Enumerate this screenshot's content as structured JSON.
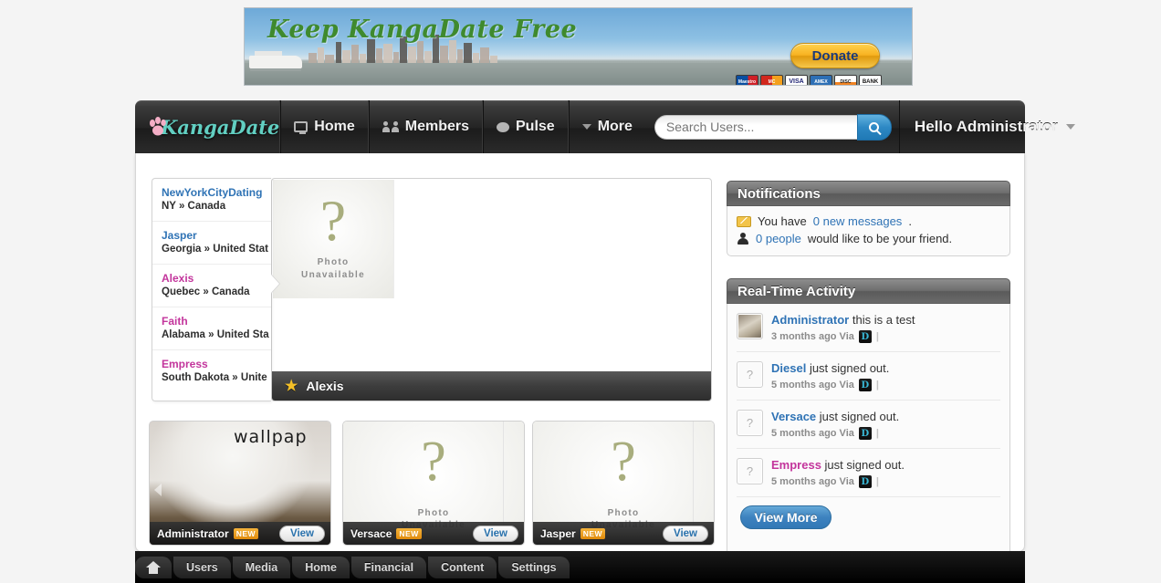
{
  "banner": {
    "title": "Keep KangaDate Free",
    "donate_label": "Donate",
    "cards": [
      "Maestro",
      "MasterCard",
      "VISA",
      "AMEX",
      "DISC/VR",
      "BANK"
    ]
  },
  "nav": {
    "logo_text": "KangaDate",
    "logo_icon": "paw-print-icon",
    "items": [
      {
        "label": "Home",
        "icon": "monitor-icon"
      },
      {
        "label": "Members",
        "icon": "members-icon"
      },
      {
        "label": "Pulse",
        "icon": "speech-bubble-icon"
      },
      {
        "label": "More",
        "icon": "caret-down-icon"
      }
    ],
    "search": {
      "placeholder": "Search Users...",
      "value": "",
      "button_icon": "search-icon"
    },
    "account_label": "Hello Administrator"
  },
  "userlist": [
    {
      "name": "NewYorkCityDating",
      "location": "NY » Canada",
      "gender": "m"
    },
    {
      "name": "Jasper",
      "location": "Georgia » United Stat",
      "gender": "m"
    },
    {
      "name": "Alexis",
      "location": "Quebec » Canada",
      "gender": "f"
    },
    {
      "name": "Faith",
      "location": "Alabama » United Sta",
      "gender": "f"
    },
    {
      "name": "Empress",
      "location": "South Dakota » Unite",
      "gender": "f"
    }
  ],
  "featured": {
    "photo_placeholder_line1": "Photo",
    "photo_placeholder_line2": "Unavailable",
    "qmark": "?",
    "caption_name": "Alexis",
    "star_icon": "star-icon"
  },
  "thumbnails": [
    {
      "name": "Administrator",
      "badge": "NEW",
      "view_label": "View",
      "photo": "wallpaper-room-photo",
      "caption_overlay_1": "",
      "caption_overlay_2": "",
      "wallpap_text": "wallpap"
    },
    {
      "name": "Versace",
      "badge": "NEW",
      "view_label": "View",
      "photo": "photo-unavailable",
      "caption_overlay_1": "Photo",
      "caption_overlay_2": "Unavailable"
    },
    {
      "name": "Jasper",
      "badge": "NEW",
      "view_label": "View",
      "photo": "photo-unavailable",
      "caption_overlay_1": "Photo",
      "caption_overlay_2": "Unavailable"
    }
  ],
  "notifications": {
    "title": "Notifications",
    "messages_prefix": "You have ",
    "messages_count": "0 new messages",
    "messages_suffix": ".",
    "friends_count": "0 people",
    "friends_suffix": " would like to be your friend."
  },
  "activity": {
    "title": "Real-Time Activity",
    "via_icon": "D",
    "items": [
      {
        "name": "Administrator",
        "gender": "m",
        "action": "this is a test",
        "time": "3 months ago Via",
        "avatar": "photo"
      },
      {
        "name": "Diesel",
        "gender": "m",
        "action": "just signed out.",
        "time": "5 months ago Via",
        "avatar": "qmark"
      },
      {
        "name": "Versace",
        "gender": "m",
        "action": "just signed out.",
        "time": "5 months ago Via",
        "avatar": "qmark"
      },
      {
        "name": "Empress",
        "gender": "f",
        "action": "just signed out.",
        "time": "5 months ago Via",
        "avatar": "qmark"
      }
    ],
    "view_more_label": "View More"
  },
  "adminbar": {
    "home_icon": "home-icon",
    "items": [
      "Users",
      "Media",
      "Home",
      "Financial",
      "Content",
      "Settings"
    ]
  },
  "colors": {
    "accent_blue": "#2f73b5",
    "accent_pink": "#c3359c",
    "brand_teal": "#62cfc2",
    "badge_orange": "#e08a0b",
    "star_yellow": "#f5c027"
  }
}
